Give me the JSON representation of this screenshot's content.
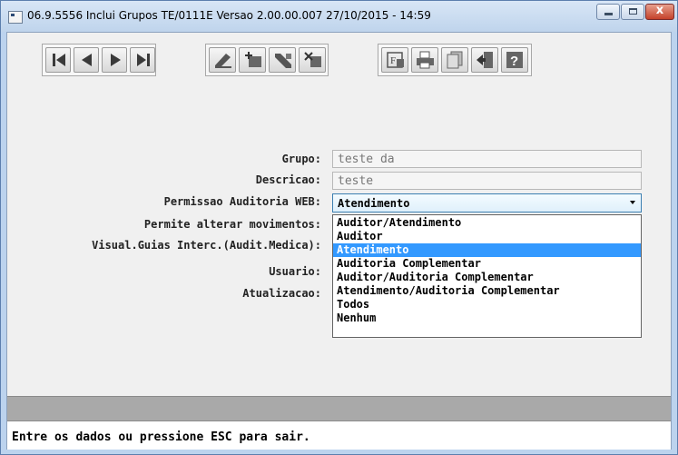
{
  "window": {
    "title": "06.9.5556  Inclui  Grupos TE/0111E Versao 2.00.00.007 27/10/2015 - 14:59",
    "close_glyph": "x"
  },
  "toolbar": {
    "nav_icons": [
      "first-record-icon",
      "previous-record-icon",
      "next-record-icon",
      "last-record-icon"
    ],
    "edit_icons": [
      "edit-icon",
      "add-icon",
      "delete-icon",
      "cancel-icon"
    ],
    "util_icons": [
      "filter-icon",
      "print-icon",
      "copy-icon",
      "exit-icon",
      "help-icon"
    ]
  },
  "form": {
    "grupo_label": "Grupo:",
    "grupo_value": "teste da",
    "descricao_label": "Descricao:",
    "descricao_value": "teste",
    "permissao_label": "Permissao Auditoria WEB:",
    "permissao_value": "Atendimento",
    "permite_label": "Permite alterar movimentos:",
    "visual_label": "Visual.Guias Interc.(Audit.Medica):",
    "usuario_label": "Usuario:",
    "atualizacao_label": "Atualizacao:"
  },
  "dropdown": {
    "options": [
      "Auditor/Atendimento",
      "Auditor",
      "Atendimento",
      "Auditoria Complementar",
      "Auditor/Auditoria Complementar",
      "Atendimento/Auditoria Complementar",
      "Todos",
      "Nenhum"
    ],
    "selected": "Atendimento"
  },
  "status": {
    "message": "Entre os dados ou pressione ESC para sair."
  },
  "colors": {
    "highlight": "#3399ff",
    "title_bar": "#bcd3ee",
    "status_gray": "#a9a9a9"
  }
}
